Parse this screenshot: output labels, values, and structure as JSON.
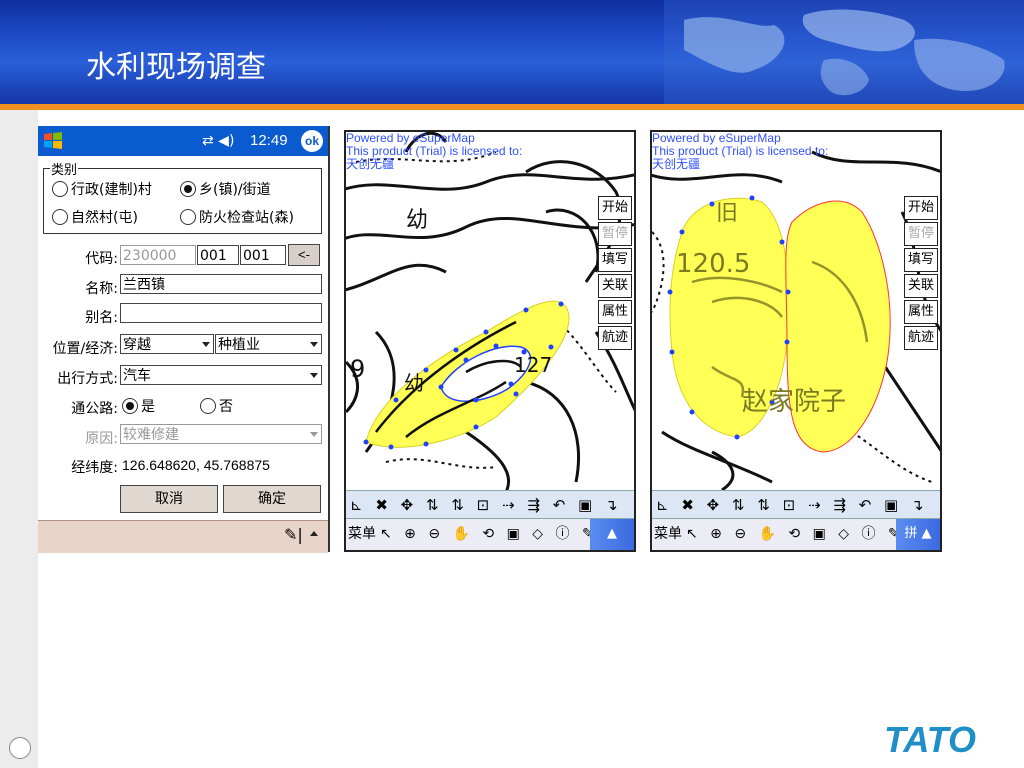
{
  "slide": {
    "title": "水利现场调查"
  },
  "phone": {
    "clock": "12:49",
    "ok_label": "ok",
    "category": {
      "legend": "类别",
      "options": [
        {
          "label": "行政(建制)村",
          "selected": false
        },
        {
          "label": "乡(镇)/街道",
          "selected": true
        },
        {
          "label": "自然村(屯)",
          "selected": false
        },
        {
          "label": "防火检查站(森)",
          "selected": false
        }
      ]
    },
    "code": {
      "label": "代码:",
      "value1": "230000",
      "value2": "001",
      "value3": "001",
      "button": "<-"
    },
    "name": {
      "label": "名称:",
      "value": "兰西镇"
    },
    "alias": {
      "label": "别名:",
      "value": ""
    },
    "position": {
      "label": "位置/经济:",
      "value1": "穿越",
      "value2": "种植业"
    },
    "travel": {
      "label": "出行方式:",
      "value": "汽车"
    },
    "road": {
      "label": "通公路:",
      "yes": "是",
      "no": "否",
      "selected": "yes"
    },
    "reason": {
      "label": "原因:",
      "value": "较难修建"
    },
    "coords": {
      "label": "经纬度:",
      "value": "126.648620, 45.768875"
    },
    "cancel_label": "取消",
    "confirm_label": "确定"
  },
  "map_left": {
    "credit": [
      "Powered by eSuperMap",
      "This product (Trial) is licensed to:",
      "天创无疆"
    ],
    "buttons": [
      {
        "label": "开始",
        "enabled": true
      },
      {
        "label": "暂停",
        "enabled": false
      },
      {
        "label": "填写",
        "enabled": true
      },
      {
        "label": "关联",
        "enabled": true
      },
      {
        "label": "属性",
        "enabled": true
      },
      {
        "label": "航迹",
        "enabled": true
      }
    ],
    "map_labels": [
      "幼",
      "幼",
      "9",
      "127"
    ],
    "toolbar1": "⊾ ✖ ✥ ⇅ ⇅ ⊡ ⇢ ⇶ ↶ ▣ ↴",
    "menu_label": "菜单",
    "toolbar2": "↖ ⊕ ⊖ ✋ ⟲ ▣ ◇ ⓘ ✎",
    "toolbar2_end": "▲"
  },
  "map_right": {
    "credit": [
      "Powered by eSuperMap",
      "This product (Trial) is licensed to:",
      "天创无疆"
    ],
    "buttons": [
      {
        "label": "开始",
        "enabled": true
      },
      {
        "label": "暂停",
        "enabled": false
      },
      {
        "label": "填写",
        "enabled": true
      },
      {
        "label": "关联",
        "enabled": true
      },
      {
        "label": "属性",
        "enabled": true
      },
      {
        "label": "航迹",
        "enabled": true
      }
    ],
    "map_labels": [
      "120.5",
      "赵家院子",
      "旧"
    ],
    "toolbar1": "⊾ ✖ ✥ ⇅ ⇅ ⊡ ⇢ ⇶ ↶ ▣ ↴",
    "menu_label": "菜单",
    "toolbar2": "↖ ⊕ ⊖ ✋ ⟲ ▣ ◇ ⓘ ✎",
    "toolbar2_end": "拼 ▲"
  },
  "brand": {
    "logo_text": "TATO"
  },
  "colors": {
    "header_blue": "#1e4bc8",
    "accent_orange": "#f09020",
    "highlight_yellow": "#ffff55",
    "vertex_blue": "#2040ff"
  }
}
